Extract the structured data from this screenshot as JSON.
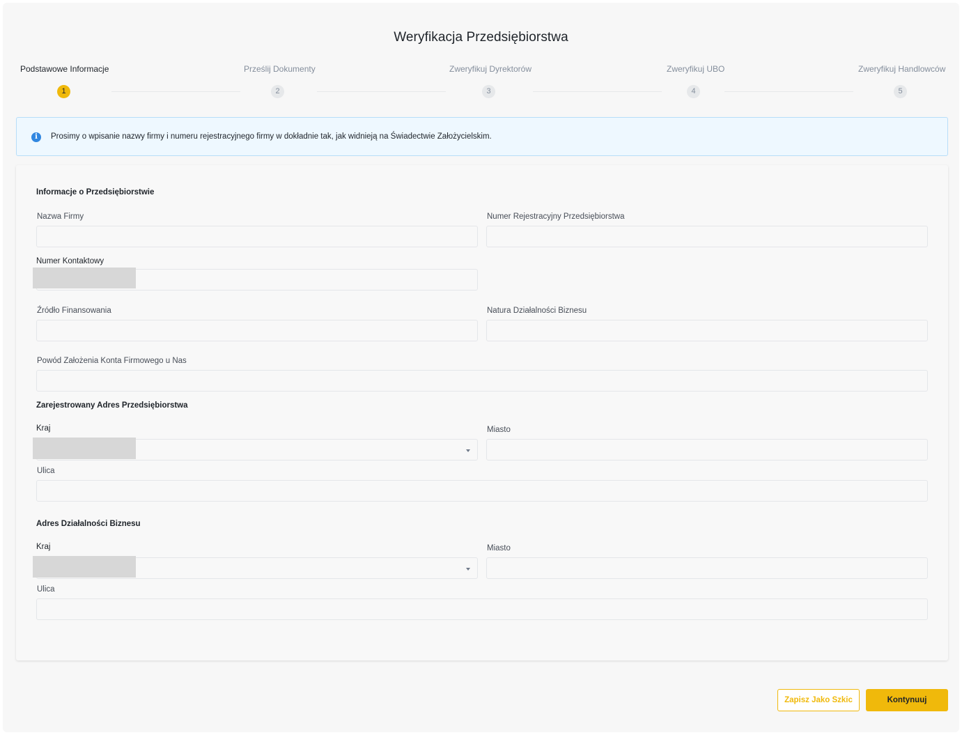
{
  "title": "Weryfikacja Przedsiębiorstwa",
  "steps": [
    {
      "label": "Podstawowe Informacje",
      "number": "1"
    },
    {
      "label": "Prześlij Dokumenty",
      "number": "2"
    },
    {
      "label": "Zweryfikuj Dyrektorów",
      "number": "3"
    },
    {
      "label": "Zweryfikuj UBO",
      "number": "4"
    },
    {
      "label": "Zweryfikuj Handlowców",
      "number": "5"
    }
  ],
  "banner": {
    "icon": "info-icon",
    "icon_glyph": "i",
    "text": "Prosimy o wpisanie nazwy firmy i numeru rejestracyjnego firmy w dokładnie tak, jak widnieją na Świadectwie Założycielskim."
  },
  "company_info": {
    "heading": "Informacje o Przedsiębiorstwie",
    "name_label": "Nazwa Firmy",
    "reg_number_label": "Numer Rejestracyjny Przedsiębiorstwa",
    "contact_label": "Numer Kontaktowy",
    "funding_label": "Źródło Finansowania",
    "business_nature_label": "Natura Działalności Biznesu",
    "reason_label": "Powód Założenia Konta Firmowego u Nas"
  },
  "registered_address": {
    "heading": "Zarejestrowany Adres Przedsiębiorstwa",
    "country_label": "Kraj",
    "city_label": "Miasto",
    "street_label": "Ulica"
  },
  "business_address": {
    "heading": "Adres Działalności Biznesu",
    "country_label": "Kraj",
    "city_label": "Miasto",
    "street_label": "Ulica"
  },
  "actions": {
    "draft_label": "Zapisz Jako Szkic",
    "continue_label": "Kontynuuj"
  },
  "colors": {
    "accent": "#f0b90b",
    "info": "#3187e0",
    "banner_bg": "#eef8ff"
  },
  "active_step": 1
}
